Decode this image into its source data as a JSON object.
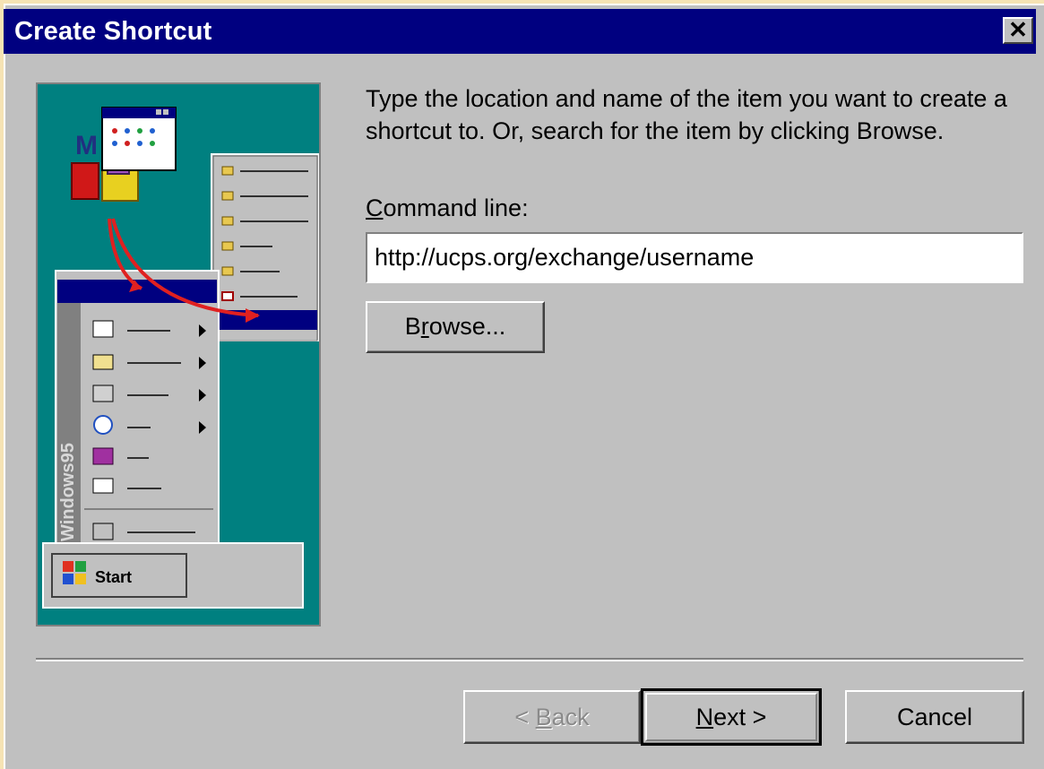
{
  "window": {
    "title": "Create Shortcut",
    "close_glyph": "✕"
  },
  "instruction": "Type the location and name of the item you want to create a shortcut to. Or, search for the item by clicking Browse.",
  "command_line": {
    "label_mnemonic": "C",
    "label_rest": "ommand line:",
    "value": "http://ucps.org/exchange/username"
  },
  "buttons": {
    "browse_pre": "B",
    "browse_mnemonic": "r",
    "browse_post": "owse...",
    "back_pre": "< ",
    "back_mnemonic": "B",
    "back_post": "ack",
    "next_mnemonic": "N",
    "next_post": "ext >",
    "cancel": "Cancel"
  },
  "illustration": {
    "taskbar_brand": "Windows95",
    "start_label": "Start"
  },
  "colors": {
    "titlebar": "#000080",
    "dialog_face": "#c0c0c0",
    "illustration_bg": "#008080",
    "arrow": "#e02020"
  }
}
